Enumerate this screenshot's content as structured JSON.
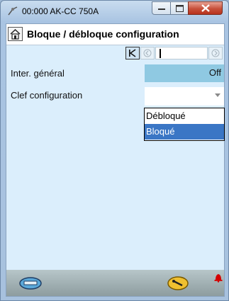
{
  "window": {
    "title": "00:000 AK-CC 750A"
  },
  "header": {
    "title": "Bloque / débloque configuration"
  },
  "rows": [
    {
      "label": "Inter. général",
      "value": "Off"
    },
    {
      "label": "Clef configuration",
      "value": ""
    }
  ],
  "dropdown": {
    "options": [
      "Débloqué",
      "Bloqué"
    ],
    "highlighted": "Bloqué"
  },
  "colors": {
    "value_cell": "#8fc9e2",
    "highlight": "#3a76c5",
    "alarm_bell": "#d40000"
  }
}
